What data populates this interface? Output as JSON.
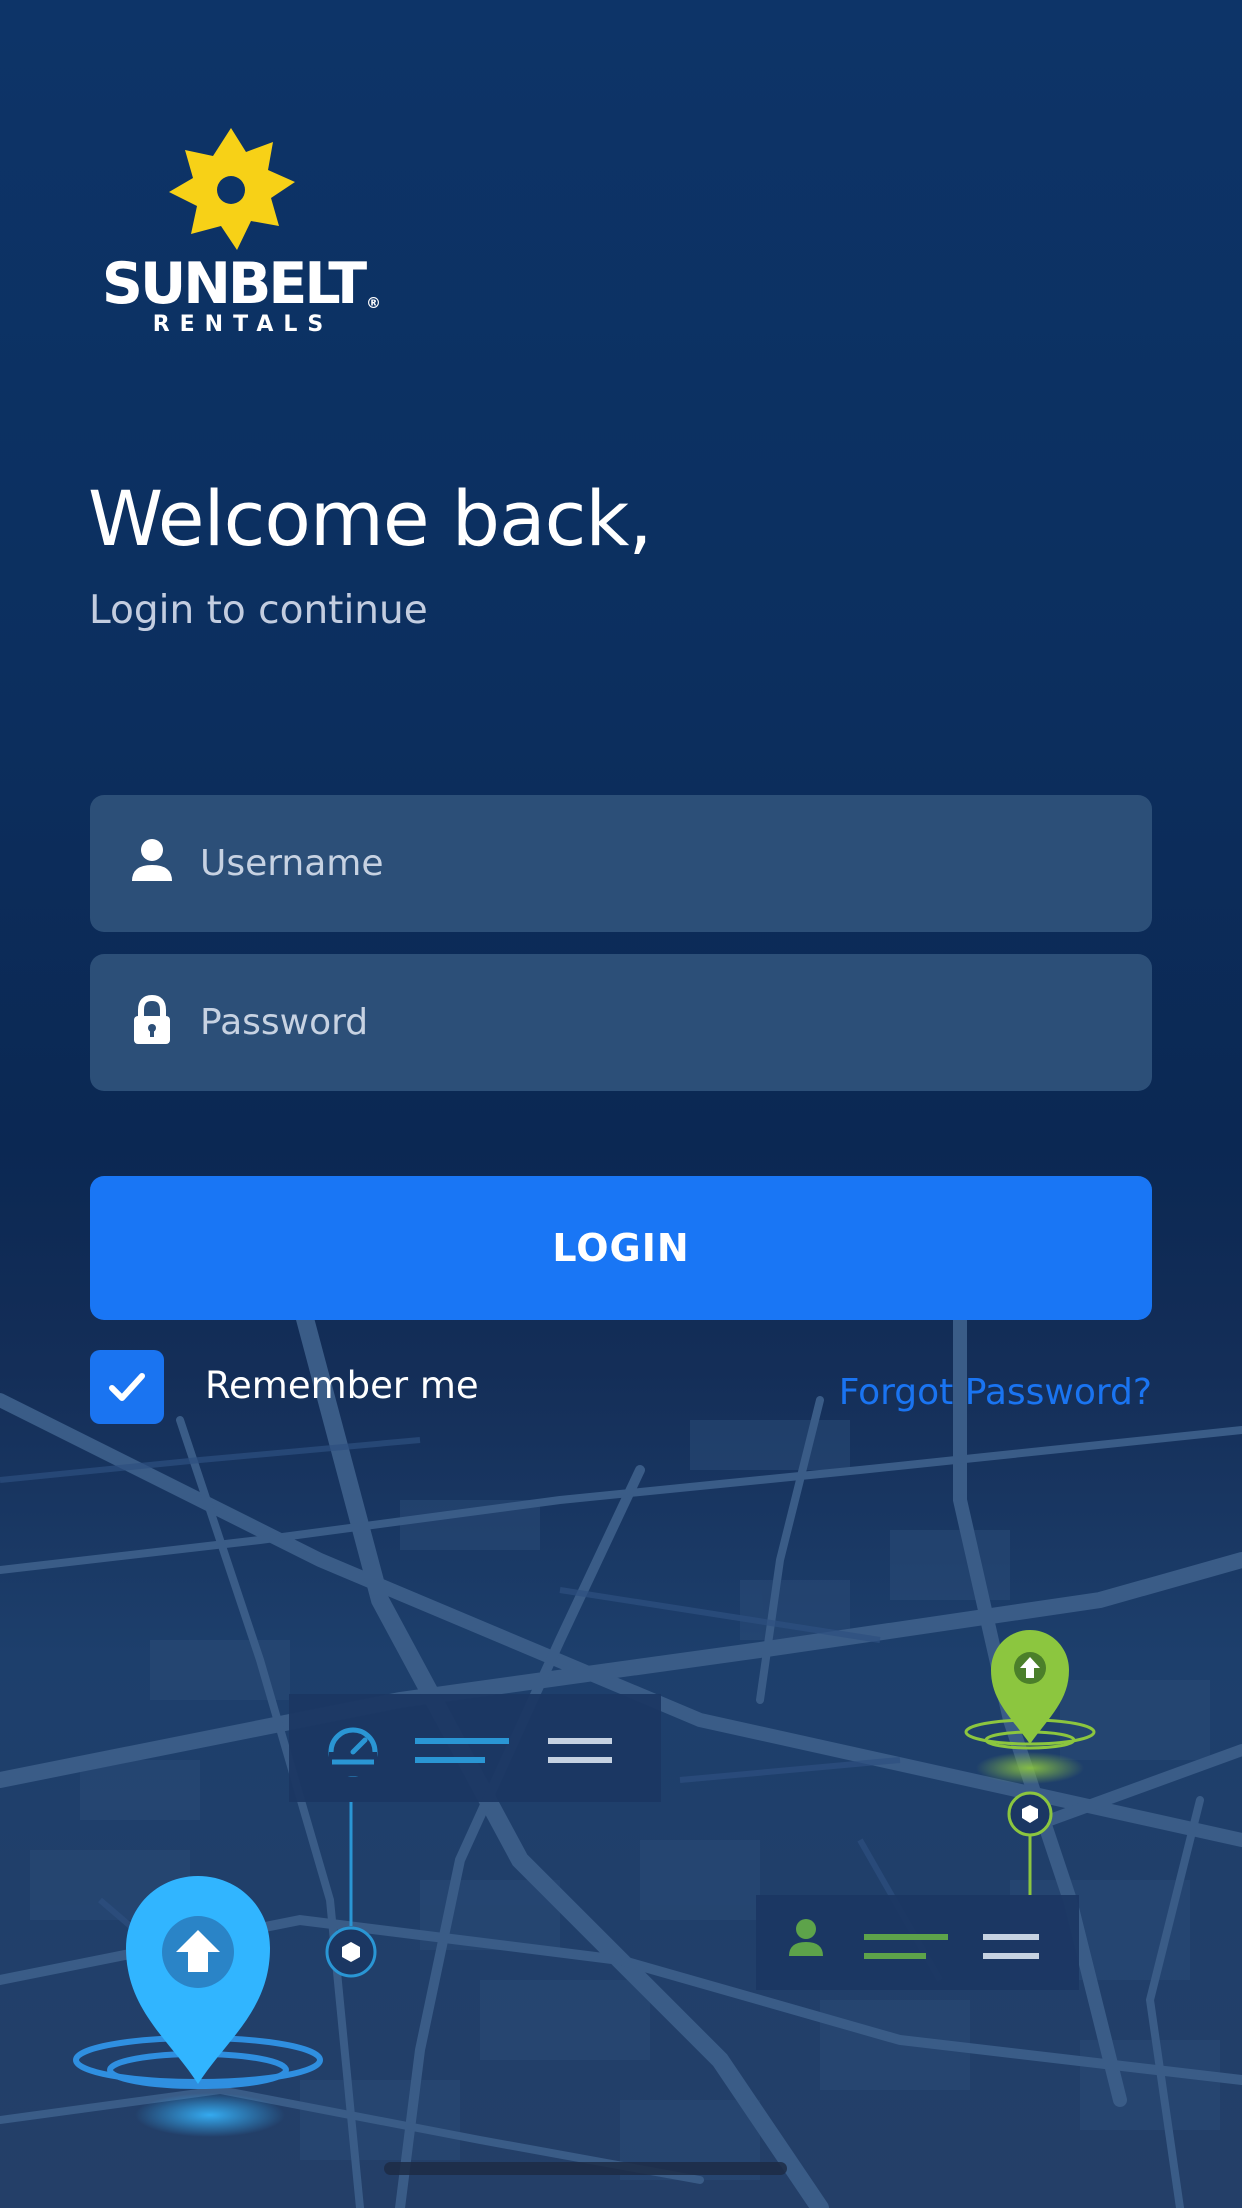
{
  "logo": {
    "wordmark": "SUNBELT",
    "registered": "®",
    "sub": "RENTALS",
    "sun_color": "#f7d117"
  },
  "header": {
    "title": "Welcome back,",
    "subtitle": "Login to continue"
  },
  "form": {
    "username_placeholder": "Username",
    "password_placeholder": "Password",
    "login_label": "LOGIN",
    "remember_label": "Remember me",
    "remember_checked": true,
    "forgot_label": "Forgot Password?"
  },
  "icons": {
    "username": "user-icon",
    "password": "lock-icon",
    "checkbox": "checkmark-icon"
  },
  "colors": {
    "background": "#0c2f5f",
    "accent": "#1976f5",
    "field": "#2c4f78",
    "pin_blue": "#31b5ff",
    "pin_green": "#8cc63f"
  }
}
